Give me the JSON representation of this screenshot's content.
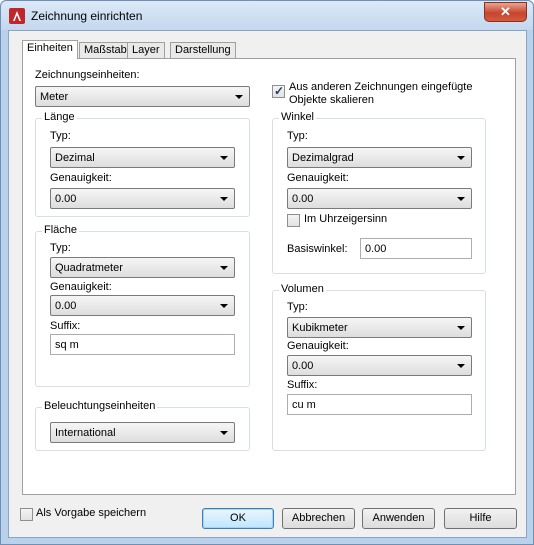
{
  "window": {
    "title": "Zeichnung einrichten",
    "close_symbol": "✕"
  },
  "tabs": [
    {
      "label": "Einheiten",
      "active": true
    },
    {
      "label": "Maßstab",
      "active": false
    },
    {
      "label": "Layer",
      "active": false
    },
    {
      "label": "Darstellung",
      "active": false
    }
  ],
  "zeichnungseinheiten": {
    "label": "Zeichnungseinheiten:",
    "value": "Meter"
  },
  "scale_inserted": {
    "checked": true,
    "label_line1": "Aus anderen Zeichnungen eingefügte",
    "label_line2": "Objekte skalieren"
  },
  "laenge": {
    "title": "Länge",
    "typ_label": "Typ:",
    "typ_value": "Dezimal",
    "genauigkeit_label": "Genauigkeit:",
    "genauigkeit_value": "0.00"
  },
  "flaeche": {
    "title": "Fläche",
    "typ_label": "Typ:",
    "typ_value": "Quadratmeter",
    "genauigkeit_label": "Genauigkeit:",
    "genauigkeit_value": "0.00",
    "suffix_label": "Suffix:",
    "suffix_value": "sq m"
  },
  "beleuchtung": {
    "title": "Beleuchtungseinheiten",
    "value": "International"
  },
  "winkel": {
    "title": "Winkel",
    "typ_label": "Typ:",
    "typ_value": "Dezimalgrad",
    "genauigkeit_label": "Genauigkeit:",
    "genauigkeit_value": "0.00",
    "uhrzeigersinn_label": "Im Uhrzeigersinn",
    "uhrzeigersinn_checked": false,
    "basiswinkel_label": "Basiswinkel:",
    "basiswinkel_value": "0.00"
  },
  "volumen": {
    "title": "Volumen",
    "typ_label": "Typ:",
    "typ_value": "Kubikmeter",
    "genauigkeit_label": "Genauigkeit:",
    "genauigkeit_value": "0.00",
    "suffix_label": "Suffix:",
    "suffix_value": "cu m"
  },
  "footer": {
    "save_default_label": "Als Vorgabe speichern",
    "save_default_checked": false,
    "ok": "OK",
    "cancel": "Abbrechen",
    "apply": "Anwenden",
    "help": "Hilfe"
  },
  "colors": {
    "accent": "#3c7fb1",
    "close": "#c7462e",
    "frame": "#b9d1ea"
  }
}
